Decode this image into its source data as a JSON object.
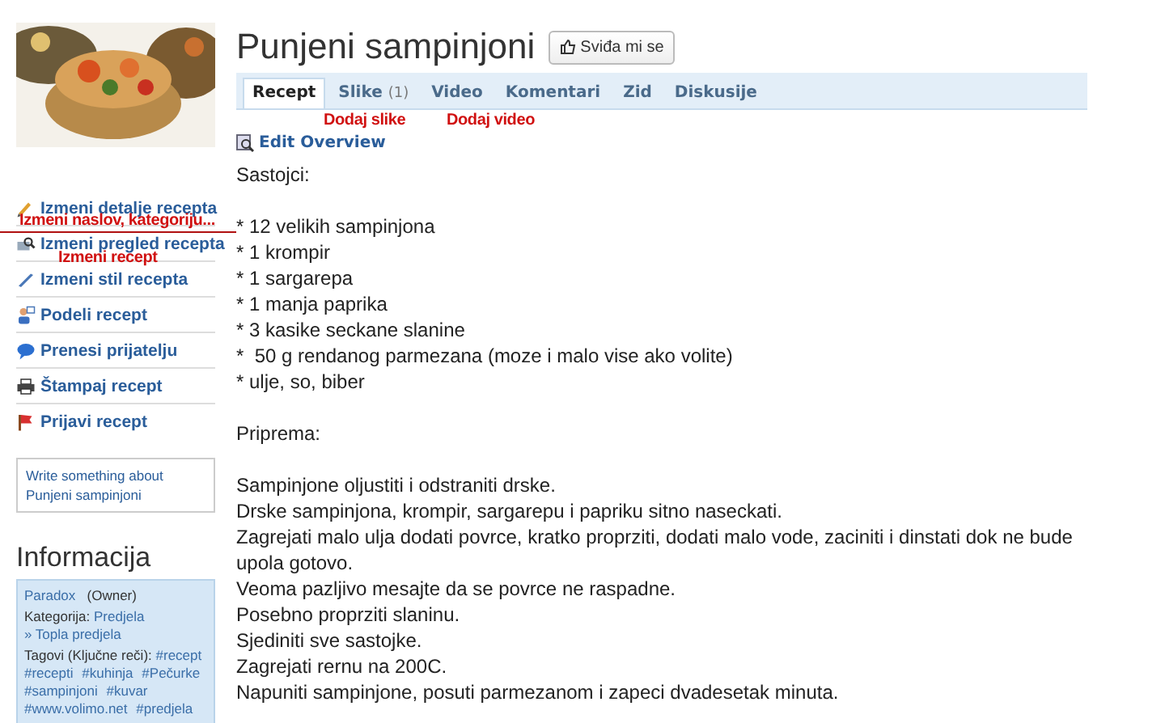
{
  "photo": {
    "kind": "picture"
  },
  "title": "Punjeni sampinjoni",
  "like_button": "Sviđa mi se",
  "tabs": [
    {
      "label": "Recept",
      "selected": true
    },
    {
      "label": "Slike",
      "count": "(1)",
      "selected": false
    },
    {
      "label": "Video",
      "selected": false
    },
    {
      "label": "Komentari",
      "selected": false
    },
    {
      "label": "Zid",
      "selected": false
    },
    {
      "label": "Diskusije",
      "selected": false
    }
  ],
  "edit_overview": "Edit Overview",
  "sidebar": {
    "actions": [
      {
        "label": "Izmeni detalje recepta"
      },
      {
        "label": "Izmeni pregled recepta"
      },
      {
        "label": "Izmeni stil recepta"
      },
      {
        "label": "Podeli recept"
      },
      {
        "label": "Prenesi prijatelju"
      },
      {
        "label": "Štampaj recept"
      },
      {
        "label": "Prijavi recept"
      }
    ],
    "note": "Write something about Punjeni sampinjoni"
  },
  "info": {
    "heading": "Informacija",
    "owner": "Paradox",
    "owner_role": "(Owner)",
    "category_label": "Kategorija:",
    "category": "Predjela",
    "subcategory": "» Topla predjela",
    "tags_label": "Tagovi (Ključne reči):",
    "tags": [
      "#recept",
      "#recepti",
      "#kuhinja",
      "#Pečurke",
      "#sampinjoni",
      "#kuvar",
      "#www.volimo.net",
      "#predjela"
    ]
  },
  "ingredients_heading": "Sastojci:",
  "ingredients": [
    "* 12 velikih sampinjona",
    "* 1 krompir",
    "* 1 sargarepa",
    "* 1 manja paprika",
    "* 3 kasike seckane slanine",
    "*  50 g rendanog parmezana (moze i malo vise ako volite)",
    "* ulje, so, biber"
  ],
  "preparation_heading": "Priprema:",
  "steps": [
    "Sampinjone oljustiti i odstraniti drske.",
    "Drske sampinjona, krompir, sargarepu i papriku sitno naseckati.",
    "Zagrejati malo ulja dodati povrce, kratko proprziti, dodati malo vode, zaciniti i dinstati dok ne bude upola gotovo.",
    "Veoma pazljivo mesajte da se povrce ne raspadne.",
    "Posebno proprziti slaninu.",
    "Sjediniti sve sastojke.",
    "Zagrejati rernu na 200C.",
    "Napuniti sampinjone, posuti parmezanom i zapeci dvadesetak minuta."
  ],
  "annotations": [
    {
      "text": "Dodaj slike"
    },
    {
      "text": "Dodaj video"
    },
    {
      "text": "Izmeni naslov, kategoriju..."
    },
    {
      "text": "Izmeni recept"
    }
  ]
}
